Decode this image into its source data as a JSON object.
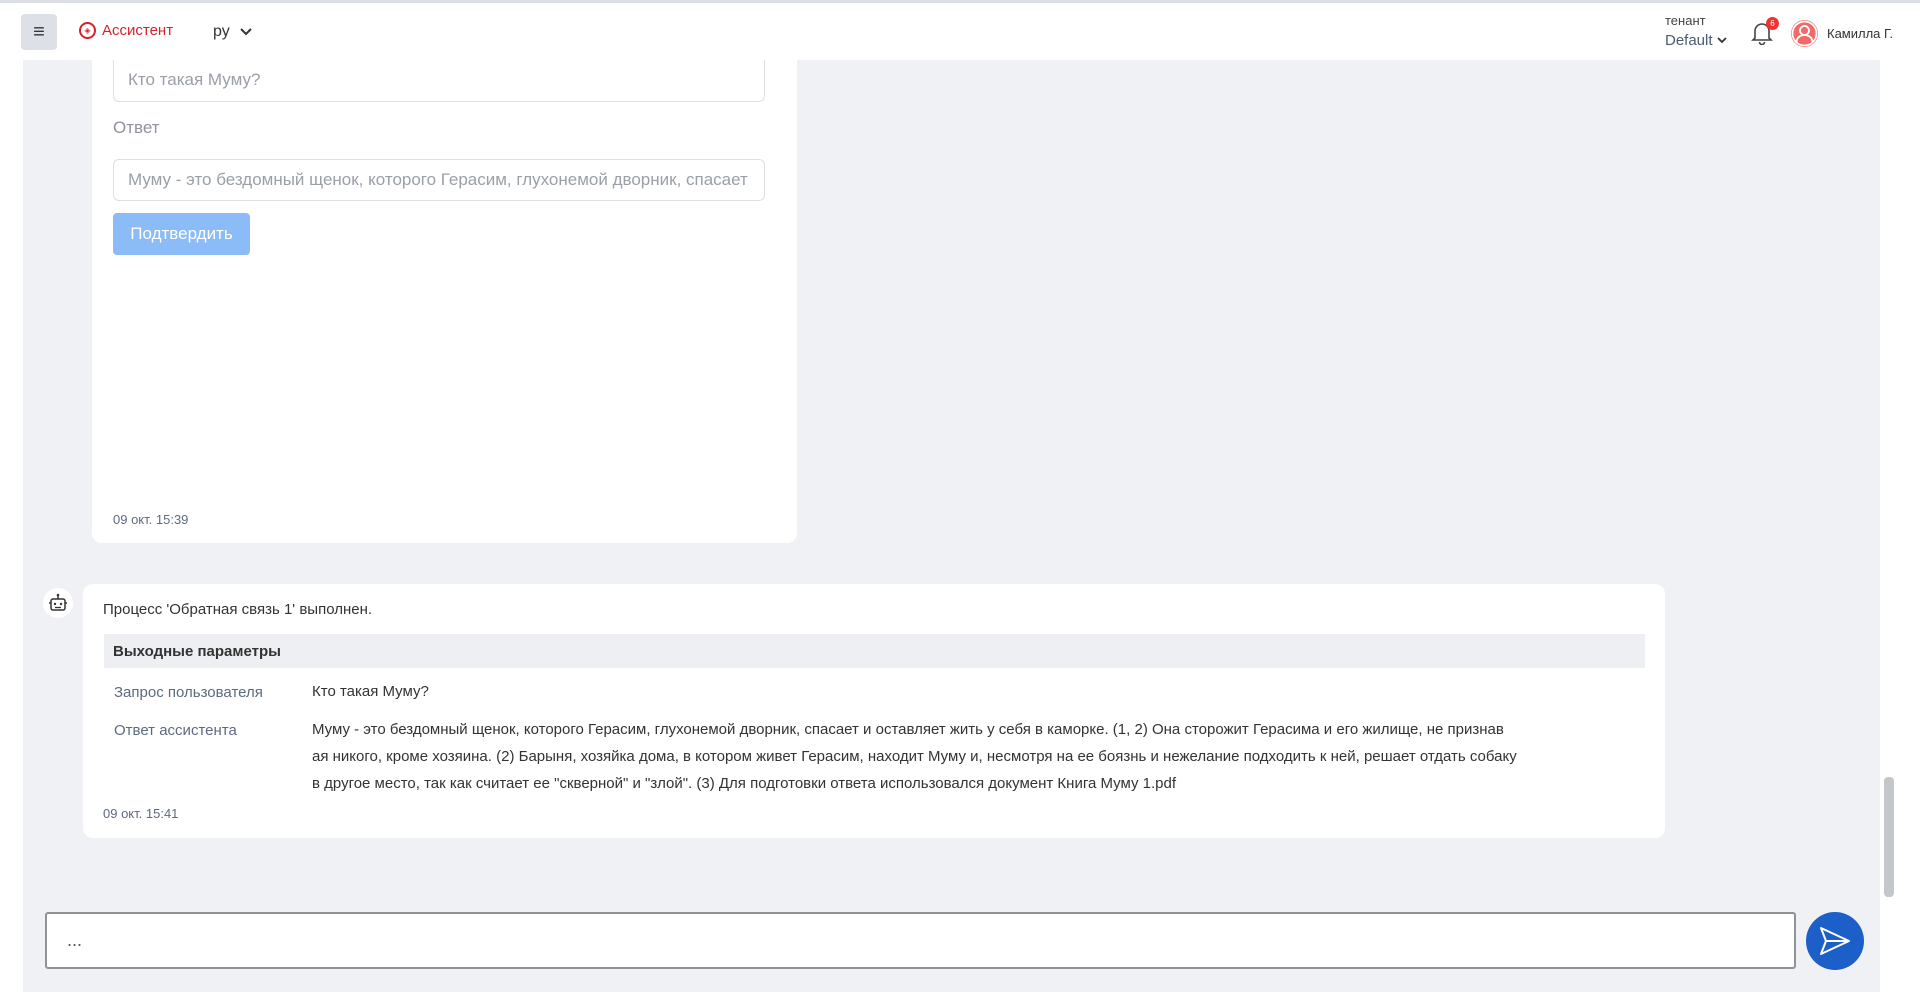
{
  "header": {
    "menu_icon": "hamburger-icon",
    "app_name": "Ассистент",
    "language": "ру",
    "tenant_label": "тенант",
    "tenant_value": "Default",
    "notifications_count": "6",
    "user_name": "Камилла Г."
  },
  "feedback_form": {
    "question_value": "Кто такая Муму?",
    "answer_label": "Ответ",
    "answer_value": "Муму - это бездомный щенок, которого Герасим, глухонемой дворник, спасает",
    "confirm_label": "Подтвердить",
    "timestamp": "09 окт. 15:39"
  },
  "bot_message": {
    "process_text": "Процесс 'Обратная связь 1' выполнен.",
    "params_title": "Выходные параметры",
    "rows": [
      {
        "label": "Запрос пользователя",
        "value": "Кто такая Муму?"
      },
      {
        "label": "Ответ ассистента",
        "value_lines": [
          "Муму - это бездомный щенок, которого Герасим, глухонемой дворник, спасает и оставляет жить у себя в каморке. (1, 2) Она сторожит Герасима и его жилище, не признав",
          "ая никого, кроме хозяина. (2) Барыня, хозяйка дома, в котором живет Герасим, находит Муму и, несмотря на ее боязнь и нежелание подходить к ней, решает отдать собаку",
          "в другое место, так как считает ее \"скверной\" и \"злой\". (3) Для подготовки ответа использовался документ Книга Муму 1.pdf"
        ]
      }
    ],
    "timestamp": "09 окт. 15:41"
  },
  "composer": {
    "value": "...",
    "send_icon": "send-icon"
  },
  "colors": {
    "brand_red": "#d4232c",
    "accent_blue": "#1d5fc9",
    "confirm_button": "#8bbcf8",
    "chat_bg": "#f0f1f5"
  }
}
